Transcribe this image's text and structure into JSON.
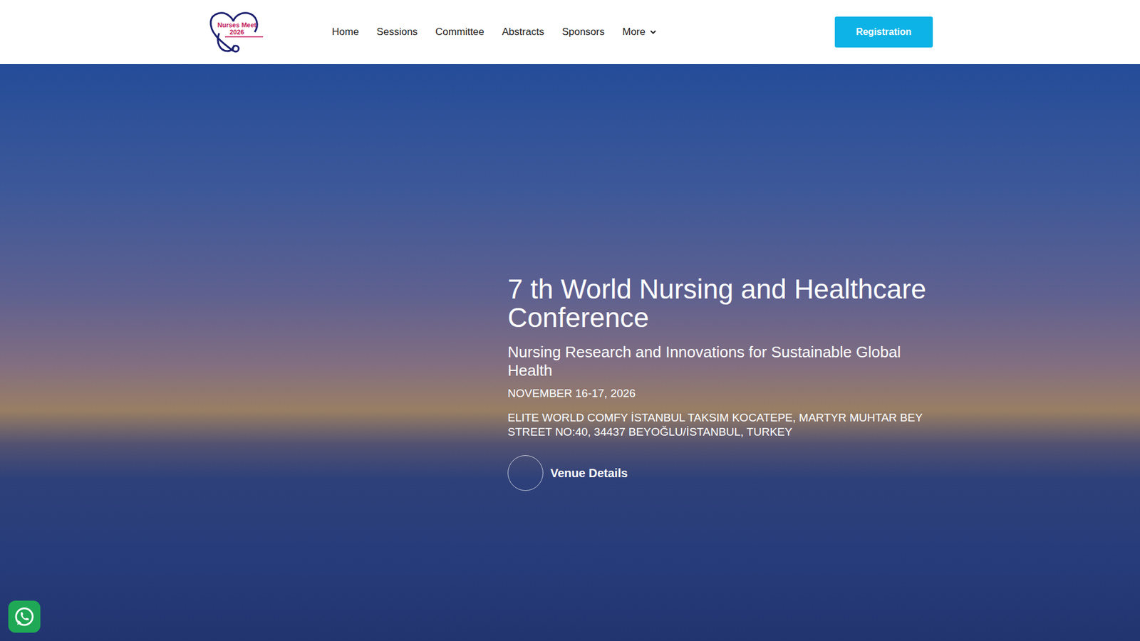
{
  "header": {
    "logo": {
      "line1": "Nurses Meet",
      "line2": "2026"
    },
    "nav": [
      {
        "label": "Home",
        "has_menu": false
      },
      {
        "label": "Sessions",
        "has_menu": false
      },
      {
        "label": "Committee",
        "has_menu": false
      },
      {
        "label": "Abstracts",
        "has_menu": false
      },
      {
        "label": "Sponsors",
        "has_menu": false
      },
      {
        "label": "More",
        "has_menu": true
      }
    ],
    "cta": "Registration"
  },
  "hero": {
    "title": "7 th World Nursing and Healthcare Conference",
    "subtitle": "Nursing Research and Innovations for Sustainable Global Health",
    "date": "NOVEMBER 16-17, 2026",
    "venue": "ELITE WORLD COMFY İSTANBUL TAKSIM KOCATEPE, MARTYR MUHTAR BEY STREET NO:40, 34437 BEYOĞLU/İSTANBUL, TURKEY",
    "button": "Venue Details"
  }
}
